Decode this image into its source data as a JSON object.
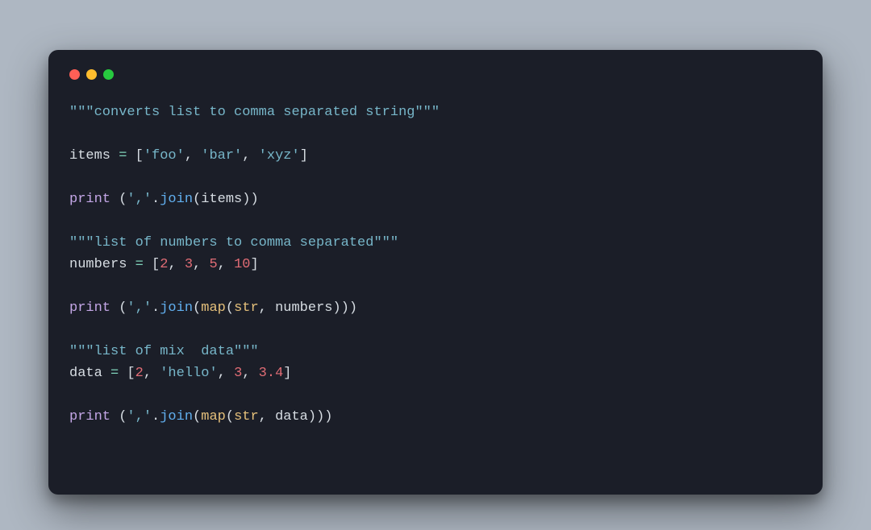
{
  "window": {
    "buttons": [
      "close",
      "minimize",
      "zoom"
    ]
  },
  "code": {
    "doc1": "\"\"\"converts list to comma separated string\"\"\"",
    "items_var": "items",
    "eq": " = ",
    "lb": "[",
    "rb": "]",
    "items_vals": [
      "'foo'",
      "'bar'",
      "'xyz'"
    ],
    "comma_sp": ", ",
    "print": "print",
    "sp": " ",
    "lp": "(",
    "rp": ")",
    "comma_str": "','",
    "dot": ".",
    "join": "join",
    "doc2": "\"\"\"list of numbers to comma separated\"\"\"",
    "numbers_var": "numbers",
    "numbers_vals": [
      "2",
      "3",
      "5",
      "10"
    ],
    "map": "map",
    "str": "str",
    "doc3": "\"\"\"list of mix  data\"\"\"",
    "data_var": "data",
    "data_vals": {
      "v0_num": "2",
      "v1_str": "'hello'",
      "v2_num": "3",
      "v3_num": "3.4"
    }
  }
}
